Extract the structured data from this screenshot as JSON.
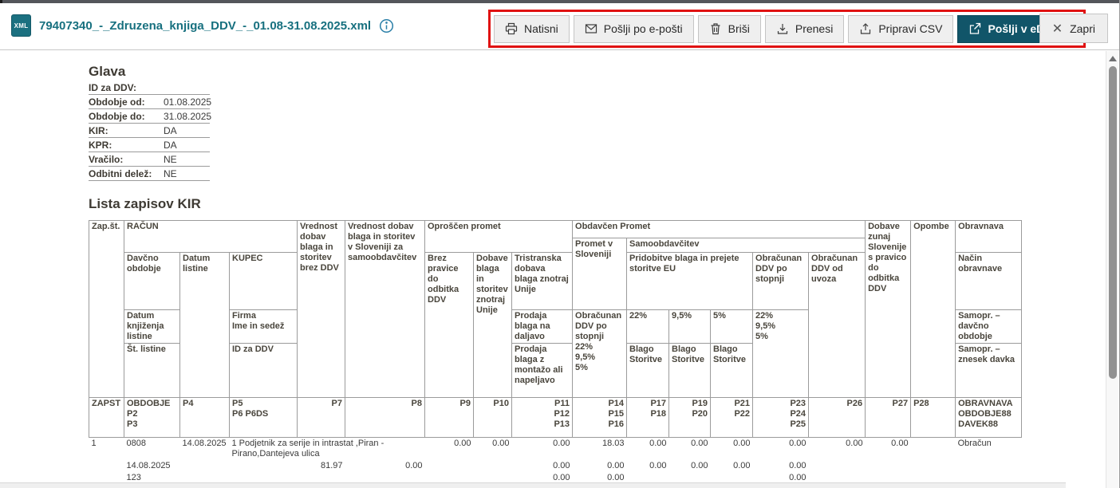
{
  "header": {
    "badge": "XML",
    "filename": "79407340_-_Zdruzena_knjiga_DDV_-_01.08-31.08.2025.xml"
  },
  "toolbar": {
    "buttons": [
      {
        "label": "Natisni",
        "icon": "printer-icon"
      },
      {
        "label": "Pošlji po e-pošti",
        "icon": "envelope-icon"
      },
      {
        "label": "Briši",
        "icon": "trash-icon"
      },
      {
        "label": "Prenesi",
        "icon": "download-icon"
      },
      {
        "label": "Pripravi CSV",
        "icon": "export-icon"
      },
      {
        "label": "Pošlji v eDavke",
        "icon": "external-link-icon"
      }
    ],
    "close_label": "Zapri"
  },
  "glava": {
    "title": "Glava",
    "rows": [
      {
        "label": "ID za DDV:",
        "value": ""
      },
      {
        "label": "Obdobje od:",
        "value": "01.08.2025"
      },
      {
        "label": "Obdobje do:",
        "value": "31.08.2025"
      },
      {
        "label": "KIR:",
        "value": "DA"
      },
      {
        "label": "KPR:",
        "value": "DA"
      },
      {
        "label": "Vračilo:",
        "value": "NE"
      },
      {
        "label": "Odbitni delež:",
        "value": "NE"
      }
    ]
  },
  "kir": {
    "title": "Lista zapisov KIR",
    "h": {
      "zap": "Zap.št.",
      "racun": "RAČUN",
      "p7": "Vrednost dobav blaga in storitev brez DDV",
      "p8": "Vrednost dobav blaga in storitev v Sloveniji za samoobdavčitev",
      "oproscen": "Oproščen promet",
      "obdavcen": "Obdavčen Promet",
      "dobave_zunaj": "Dobave zunaj Slovenije s pravico do odbitka DDV",
      "opombe": "Opombe",
      "obravnava": "Obravnava",
      "promet_si": "Promet v Sloveniji",
      "samoobd": "Samoobdavčitev",
      "davcno": "Davčno obdobje",
      "datum_listine": "Datum listine",
      "kupec": "KUPEC",
      "brez_pravice": "Brez pravice do odbitka DDV",
      "dobave_unija": "Dobave blaga in storitev znotraj Unije",
      "tristranska": "Tristranska dobava blaga znotraj Unije",
      "pridobitve": "Pridobitve blaga in prejete storitve EU",
      "obracunan_stopnja": "Obračunan DDV po stopnji",
      "obracunan_uvoz": "Obračunan DDV od uvoza",
      "nacin": "Način obravnave",
      "datum_knjizenja": "Datum knjiženja listine",
      "firma": "Firma\nIme in sedež",
      "prodaja_daljavo": "Prodaja blaga na daljavo",
      "promet_si_sub": "Obračunan DDV po stopnji\n22%\n9,5%\n5%",
      "pct22": "22%",
      "pct95": "9,5%",
      "pct5": "5%",
      "stopnje_stack": "22%\n9,5%\n5%",
      "samopr_obdobje": "Samopr. – davčno obdobje",
      "st_listine": "Št. listine",
      "id_ddv": "ID za DDV",
      "prodaja_montaza": "Prodaja blaga z montažo ali napeljavo",
      "blago_storitve": "Blago\nStoritve",
      "samopr_znesek": "Samopr. – znesek davka"
    },
    "zapst": {
      "c1": "ZAPST",
      "c2": "OBDOBJE\nP2\nP3",
      "c3": "P4",
      "c4": "P5\nP6 P6DS",
      "c5": "P7",
      "c6": "P8",
      "c7": "P9",
      "c8": "P10",
      "c9": "P11\nP12\nP13",
      "c10": "P14\nP15\nP16",
      "c11": "P17\nP18",
      "c12": "P19\nP20",
      "c13": "P21\nP22",
      "c14": "P23\nP24\nP25",
      "c15": "P26",
      "c16": "P27",
      "c17": "P28",
      "c18": "OBRAVNAVA\nOBDOBJE88\nDAVEK88"
    },
    "row1": {
      "sub1": {
        "zap": "1",
        "davcno": "0808",
        "datum": "14.08.2025",
        "kupec": "1 Podjetnik za serije in intrastat ,Piran - Pirano,Dantejeva ulica",
        "p9": "0.00",
        "p10": "0.00",
        "p11": "0.00",
        "p14": "18.03",
        "p17": "0.00",
        "p19": "0.00",
        "p21": "0.00",
        "p23": "0.00",
        "p26": "0.00",
        "p27": "0.00",
        "p28": "",
        "obravnava": "Obračun"
      },
      "sub2": {
        "davcno": "14.08.2025",
        "p7": "81.97",
        "p8": "0.00",
        "p11": "0.00",
        "p14": "0.00",
        "p17": "0.00",
        "p19": "0.00",
        "p21": "0.00",
        "p23": "0.00"
      },
      "sub3": {
        "davcno": "123",
        "p11": "0.00",
        "p14": "0.00",
        "p23": "0.00"
      }
    }
  },
  "colors": {
    "brand_teal": "#115569",
    "link_teal": "#17707f",
    "highlight_red": "#e01212"
  }
}
